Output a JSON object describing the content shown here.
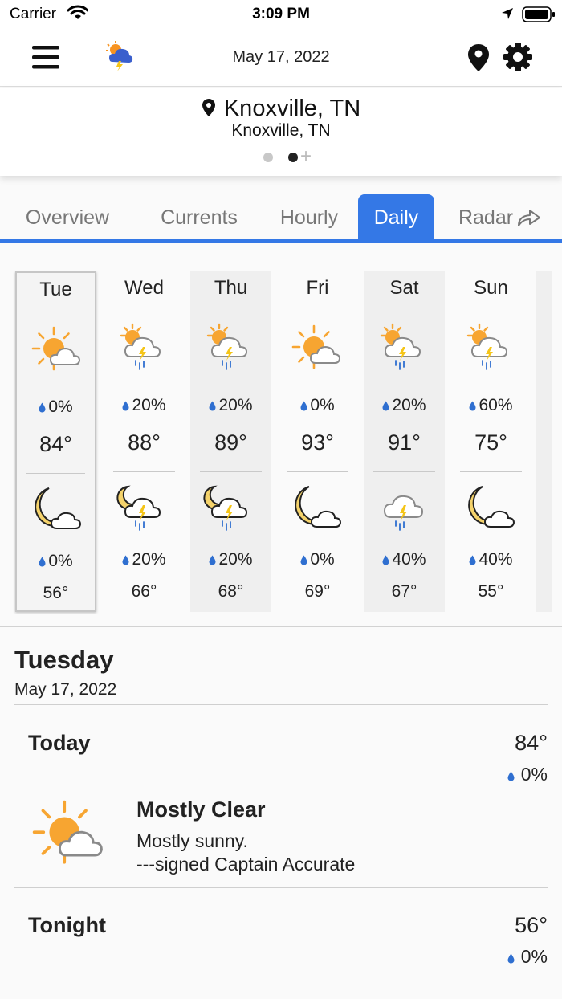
{
  "status_bar": {
    "carrier": "Carrier",
    "time": "3:09 PM"
  },
  "header": {
    "date": "May 17, 2022"
  },
  "location": {
    "title": "Knoxville, TN",
    "subtitle": "Knoxville, TN",
    "page_count": 2,
    "active_page": 2
  },
  "tabs": [
    {
      "label": "Overview",
      "active": false
    },
    {
      "label": "Currents",
      "active": false
    },
    {
      "label": "Hourly",
      "active": false
    },
    {
      "label": "Daily",
      "active": true
    },
    {
      "label": "Radar",
      "active": false
    }
  ],
  "colors": {
    "accent": "#3478e6",
    "sun": "#f7a531",
    "moon": "#f5d36b",
    "rain": "#2f6fd0",
    "bolt": "#f5c518"
  },
  "days": [
    {
      "name": "Tue",
      "day_icon": "partly-sunny-icon",
      "day_precip": "0%",
      "high": "84°",
      "night_icon": "moon-cloud-icon",
      "night_precip": "0%",
      "low": "56°"
    },
    {
      "name": "Wed",
      "day_icon": "sun-thunderstorm-icon",
      "day_precip": "20%",
      "high": "88°",
      "night_icon": "moon-thunderstorm-icon",
      "night_precip": "20%",
      "low": "66°"
    },
    {
      "name": "Thu",
      "day_icon": "sun-thunderstorm-icon",
      "day_precip": "20%",
      "high": "89°",
      "night_icon": "moon-thunderstorm-icon",
      "night_precip": "20%",
      "low": "68°"
    },
    {
      "name": "Fri",
      "day_icon": "partly-sunny-icon",
      "day_precip": "0%",
      "high": "93°",
      "night_icon": "moon-cloud-icon",
      "night_precip": "0%",
      "low": "69°"
    },
    {
      "name": "Sat",
      "day_icon": "sun-thunderstorm-icon",
      "day_precip": "20%",
      "high": "91°",
      "night_icon": "thunderstorm-icon",
      "night_precip": "40%",
      "low": "67°"
    },
    {
      "name": "Sun",
      "day_icon": "sun-thunderstorm-icon",
      "day_precip": "60%",
      "high": "75°",
      "night_icon": "moon-cloud-icon",
      "night_precip": "40%",
      "low": "55°"
    }
  ],
  "detail": {
    "day": "Tuesday",
    "date": "May 17, 2022",
    "today": {
      "title": "Today",
      "temp": "84°",
      "precip": "0%",
      "icon": "partly-sunny-icon",
      "condition": "Mostly Clear",
      "description": "Mostly sunny.",
      "signature": "---signed Captain Accurate"
    },
    "tonight": {
      "title": "Tonight",
      "temp": "56°",
      "precip": "0%"
    }
  }
}
